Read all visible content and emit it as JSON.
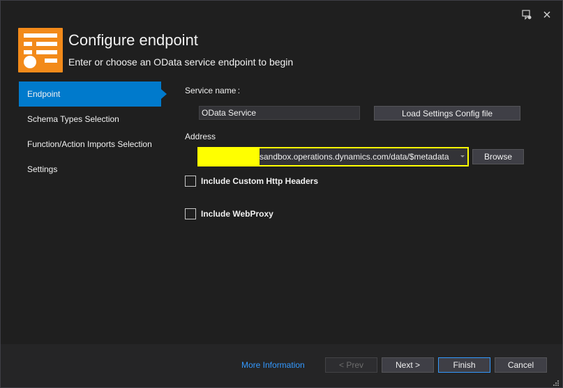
{
  "header": {
    "title": "Configure endpoint",
    "subtitle": "Enter or choose an OData service endpoint to begin"
  },
  "sidebar": {
    "items": [
      {
        "label": "Endpoint",
        "active": true
      },
      {
        "label": "Schema Types Selection"
      },
      {
        "label": "Function/Action Imports Selection"
      },
      {
        "label": "Settings"
      }
    ]
  },
  "form": {
    "service_name_label": "Service name :",
    "service_name_value": "OData Service",
    "load_settings_label": "Load Settings Config file",
    "address_label": "Address",
    "address_value": "sandbox.operations.dynamics.com/data/$metadata",
    "browse_label": "Browse",
    "custom_headers_label": "Include Custom Http Headers",
    "webproxy_label": "Include WebProxy"
  },
  "footer": {
    "more_info": "More Information",
    "prev": "< Prev",
    "next": "Next >",
    "finish": "Finish",
    "cancel": "Cancel"
  },
  "colors": {
    "accent": "#007acc",
    "logo": "#f28a1a",
    "highlight": "#ffff00",
    "link": "#3399ff"
  }
}
